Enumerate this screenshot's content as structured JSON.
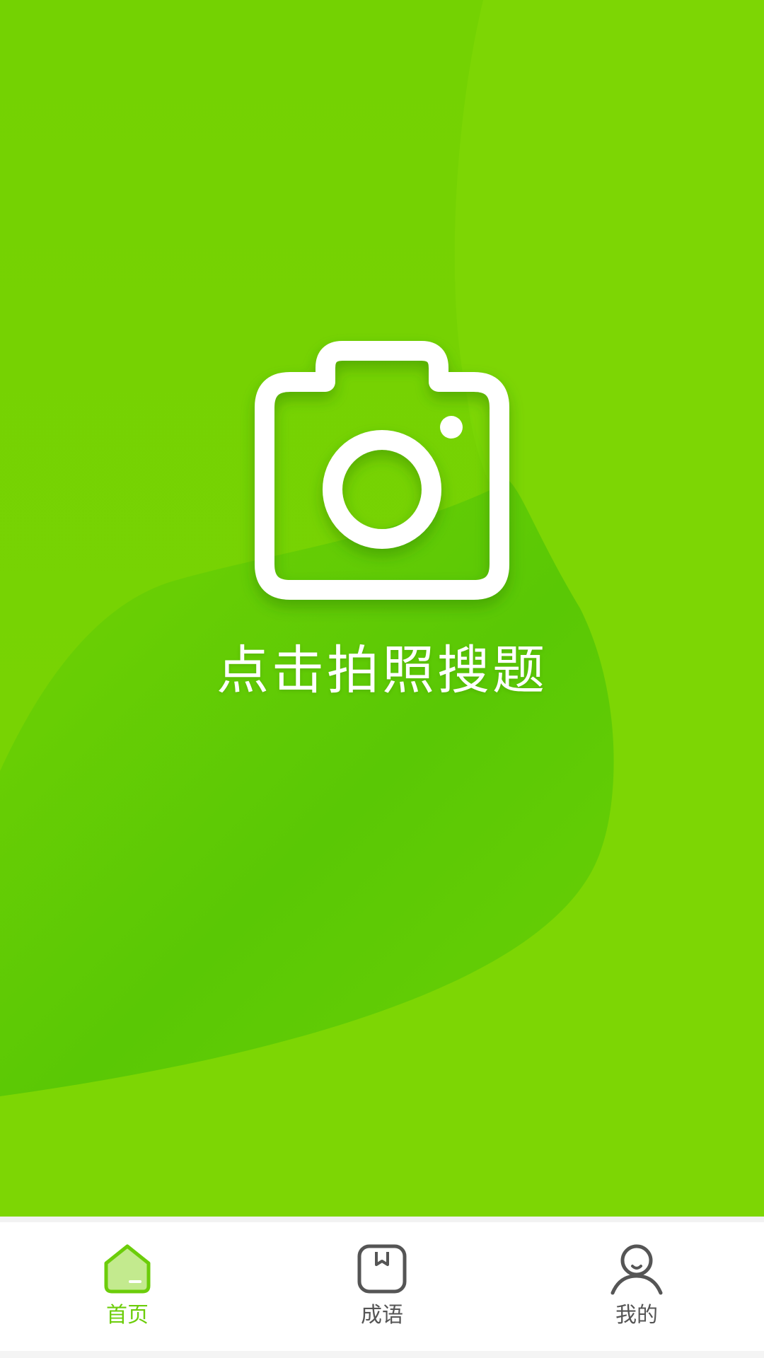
{
  "theme": {
    "primary": "#7dd604",
    "primary_dark": "#5ac805",
    "accent_active": "#6ccd0a",
    "icon_inactive": "#555555",
    "background": "#ffffff"
  },
  "hero": {
    "camera_icon": "camera-icon",
    "caption": "点击拍照搜题"
  },
  "tabbar": {
    "active_index": 0,
    "tabs": [
      {
        "label": "首页",
        "icon": "home-icon",
        "active": true
      },
      {
        "label": "成语",
        "icon": "book-icon",
        "active": false
      },
      {
        "label": "我的",
        "icon": "user-icon",
        "active": false
      }
    ]
  }
}
